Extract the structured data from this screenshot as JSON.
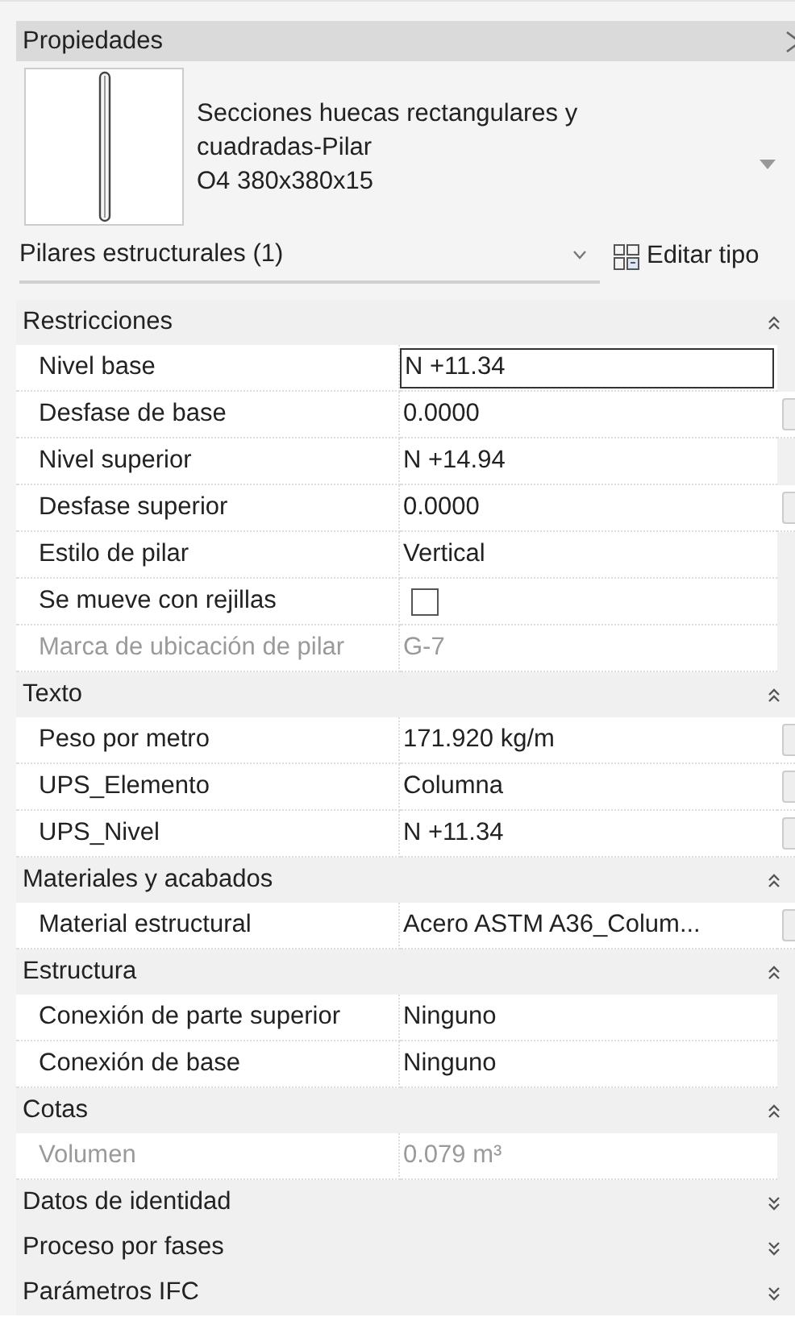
{
  "panel": {
    "title": "Propiedades"
  },
  "type_selector": {
    "family": "Secciones huecas rectangulares y cuadradas-Pilar",
    "type": "O4 380x380x15"
  },
  "category": {
    "label": "Pilares estructurales (1)",
    "edit_type": "Editar tipo"
  },
  "sections": [
    {
      "name": "Restricciones",
      "expanded": true,
      "rows": [
        {
          "label": "Nivel base",
          "value": "N +11.34",
          "kind": "text",
          "editing": true,
          "disabled": false,
          "button": false
        },
        {
          "label": "Desfase de base",
          "value": "0.0000",
          "kind": "text",
          "editing": false,
          "disabled": false,
          "button": true
        },
        {
          "label": "Nivel superior",
          "value": "N +14.94",
          "kind": "text",
          "editing": false,
          "disabled": false,
          "button": false
        },
        {
          "label": "Desfase superior",
          "value": "0.0000",
          "kind": "text",
          "editing": false,
          "disabled": false,
          "button": true
        },
        {
          "label": "Estilo de pilar",
          "value": "Vertical",
          "kind": "text",
          "editing": false,
          "disabled": false,
          "button": false
        },
        {
          "label": "Se mueve con rejillas",
          "kind": "checkbox",
          "checked": false,
          "editing": false,
          "disabled": false,
          "button": false
        },
        {
          "label": "Marca de ubicación de pilar",
          "value": "G-7",
          "kind": "text",
          "editing": false,
          "disabled": true,
          "button": false
        }
      ]
    },
    {
      "name": "Texto",
      "expanded": true,
      "rows": [
        {
          "label": "Peso por metro",
          "value": "171.920 kg/m",
          "kind": "text",
          "editing": false,
          "disabled": false,
          "button": true
        },
        {
          "label": "UPS_Elemento",
          "value": "Columna",
          "kind": "text",
          "editing": false,
          "disabled": false,
          "button": true
        },
        {
          "label": "UPS_Nivel",
          "value": "N +11.34",
          "kind": "text",
          "editing": false,
          "disabled": false,
          "button": true
        }
      ]
    },
    {
      "name": "Materiales y acabados",
      "expanded": true,
      "rows": [
        {
          "label": "Material estructural",
          "value": "Acero ASTM A36_Colum...",
          "kind": "text",
          "editing": false,
          "disabled": false,
          "button": true
        }
      ]
    },
    {
      "name": "Estructura",
      "expanded": true,
      "rows": [
        {
          "label": "Conexión de parte superior",
          "value": "Ninguno",
          "kind": "text",
          "editing": false,
          "disabled": false,
          "button": false
        },
        {
          "label": "Conexión de base",
          "value": "Ninguno",
          "kind": "text",
          "editing": false,
          "disabled": false,
          "button": false
        }
      ]
    },
    {
      "name": "Cotas",
      "expanded": true,
      "rows": [
        {
          "label": "Volumen",
          "value": "0.079 m³",
          "kind": "text",
          "editing": false,
          "disabled": true,
          "button": false
        }
      ]
    },
    {
      "name": "Datos de identidad",
      "expanded": false
    },
    {
      "name": "Proceso por fases",
      "expanded": false
    },
    {
      "name": "Parámetros IFC",
      "expanded": false
    }
  ]
}
